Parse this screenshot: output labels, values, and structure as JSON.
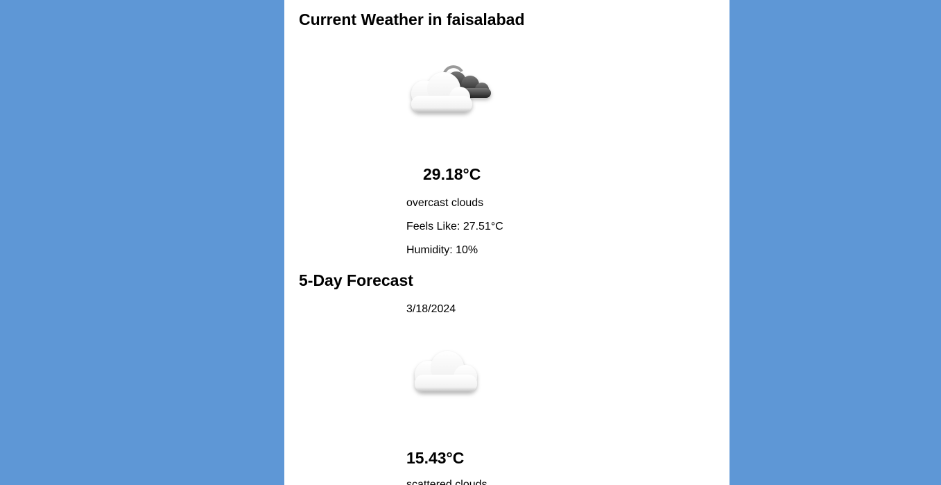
{
  "current": {
    "title": "Current Weather in faisalabad",
    "icon": "overcast-clouds-icon",
    "temperature": "29.18°C",
    "description": "overcast clouds",
    "feels_like": "Feels Like: 27.51°C",
    "humidity": "Humidity: 10%"
  },
  "forecast": {
    "title": "5-Day Forecast",
    "days": [
      {
        "date": "3/18/2024",
        "icon": "scattered-clouds-icon",
        "temperature": "15.43°C",
        "description": "scattered clouds"
      }
    ]
  },
  "colors": {
    "background": "#5e97d6",
    "card": "#ffffff",
    "text": "#000000"
  }
}
